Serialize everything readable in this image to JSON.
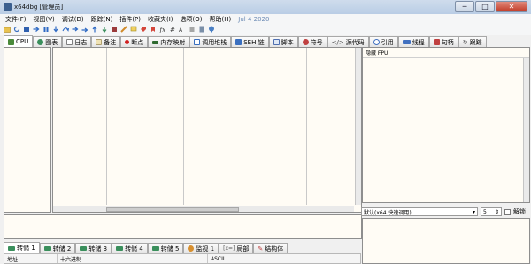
{
  "window": {
    "title": "x64dbg [管理员]",
    "buttons": {
      "minimize": "─",
      "maximize": "□",
      "close": "✕"
    }
  },
  "menu": {
    "items": [
      "文件(F)",
      "视图(V)",
      "调试(D)",
      "跟踪(N)",
      "插件(P)",
      "收藏夹(I)",
      "选项(O)",
      "帮助(H)"
    ],
    "date": "Jul 4 2020"
  },
  "tabs": [
    {
      "label": "CPU",
      "icon": "cpu-icon",
      "color": "#4a8a3a"
    },
    {
      "label": "图表",
      "icon": "graph-icon",
      "color": "#3a8f5c"
    },
    {
      "label": "日志",
      "icon": "log-icon",
      "color": "#7f7f7f"
    },
    {
      "label": "备注",
      "icon": "notes-icon",
      "color": "#b0a070"
    },
    {
      "label": "断点",
      "icon": "breakpoint-icon",
      "color": "#d02020"
    },
    {
      "label": "内存映射",
      "icon": "memory-map-icon",
      "color": "#2f6a2f"
    },
    {
      "label": "调用堆栈",
      "icon": "call-stack-icon",
      "color": "#3a6fbf"
    },
    {
      "label": "SEH 链",
      "icon": "seh-chain-icon",
      "color": "#3a6fbf"
    },
    {
      "label": "脚本",
      "icon": "script-icon",
      "color": "#4f6fb0"
    },
    {
      "label": "符号",
      "icon": "symbol-icon",
      "color": "#c04040"
    },
    {
      "label": "源代码",
      "icon": "source-icon",
      "color": "#444444"
    },
    {
      "label": "引用",
      "icon": "references-icon",
      "color": "#4070c0"
    },
    {
      "label": "线程",
      "icon": "threads-icon",
      "color": "#4070c0"
    },
    {
      "label": "句柄",
      "icon": "handles-icon",
      "color": "#c04040"
    },
    {
      "label": "跟踪",
      "icon": "trace-icon",
      "color": "#555555"
    }
  ],
  "registers": {
    "hide_fpu": "隐藏 FPU"
  },
  "callconv": {
    "value": "默认(x64 快速调用)",
    "count": "5",
    "unlock": "解锁"
  },
  "bottom_tabs": [
    {
      "label": "转储 1",
      "icon": "dump-icon"
    },
    {
      "label": "转储 2",
      "icon": "dump-icon"
    },
    {
      "label": "转储 3",
      "icon": "dump-icon"
    },
    {
      "label": "转储 4",
      "icon": "dump-icon"
    },
    {
      "label": "转储 5",
      "icon": "dump-icon"
    },
    {
      "label": "监视 1",
      "icon": "watch-icon"
    },
    {
      "label": "局部",
      "icon": "locals-icon"
    },
    {
      "label": "结构体",
      "icon": "struct-icon"
    }
  ],
  "dump_columns": [
    "地址",
    "十六进制",
    "ASCII"
  ]
}
